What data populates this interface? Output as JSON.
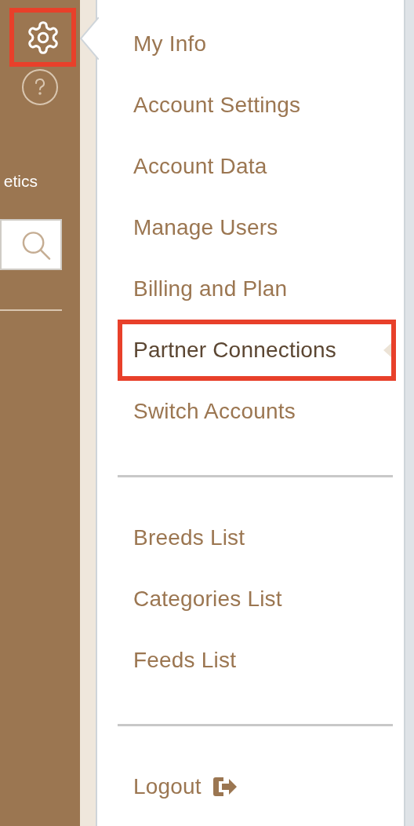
{
  "sidebar": {
    "settings_button": {
      "highlighted": true
    },
    "label": "etics"
  },
  "menu": {
    "sections": [
      {
        "items": [
          {
            "label": "My Info",
            "selected": false,
            "highlighted": false
          },
          {
            "label": "Account Settings",
            "selected": false,
            "highlighted": false
          },
          {
            "label": "Account Data",
            "selected": false,
            "highlighted": false
          },
          {
            "label": "Manage Users",
            "selected": false,
            "highlighted": false
          },
          {
            "label": "Billing and Plan",
            "selected": false,
            "highlighted": false
          },
          {
            "label": "Partner Connections",
            "selected": true,
            "highlighted": true
          },
          {
            "label": "Switch Accounts",
            "selected": false,
            "highlighted": false
          }
        ]
      },
      {
        "items": [
          {
            "label": "Breeds List",
            "selected": false,
            "highlighted": false
          },
          {
            "label": "Categories List",
            "selected": false,
            "highlighted": false
          },
          {
            "label": "Feeds List",
            "selected": false,
            "highlighted": false
          }
        ]
      },
      {
        "items": [
          {
            "label": "Logout",
            "selected": false,
            "highlighted": false,
            "kind": "logout"
          }
        ]
      }
    ]
  }
}
